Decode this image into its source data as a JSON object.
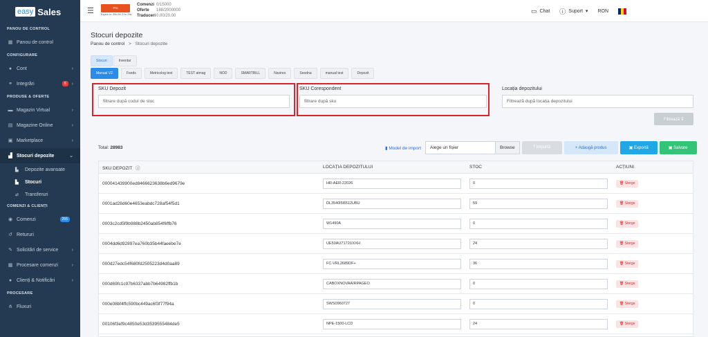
{
  "brand": {
    "part1": "easy",
    "part2": "Sales"
  },
  "sidebar": {
    "sections": {
      "panou": "PANOU DE CONTROL",
      "configurare": "CONFIGURARE",
      "produse": "PRODUSE & OFERTE",
      "comenzi": "COMENZI & CLIENȚI",
      "procesare": "PROCESARE"
    },
    "items": {
      "panou_control": "Panou de control",
      "cont": "Cont",
      "integrari": "Integrări",
      "integrari_badge": "6",
      "magazin_virtual": "Magazin Virtual",
      "magazine_online": "Magazine Online",
      "marketplace": "Marketplace",
      "stocuri_depozite": "Stocuri depozite",
      "depozite_avansate": "Depozite avansate",
      "stocuri": "Stocuri",
      "transferuri": "Transferuri",
      "comenzi": "Comenzi",
      "comenzi_badge": "255",
      "retururi": "Retururi",
      "solicitari": "Solicitări de service",
      "procesare_comenzi": "Procesare comenzi",
      "clienti": "Clienți & Notificări",
      "fluxuri": "Fluxuri"
    },
    "colors": {
      "badge_red": "#e53e3e",
      "badge_blue": "#2a8be8"
    }
  },
  "topbar": {
    "plan": "Pro",
    "expiry": "Expiră în: 35d 6h 37m 29s",
    "comenzi_label": "Comenzi",
    "comenzi_value": "0/15000",
    "oferte_label": "Oferte",
    "oferte_value": "188/2000000",
    "traduceri_label": "Traduceri",
    "traduceri_value": "0.00/20.00",
    "chat": "Chat",
    "suport": "Suport",
    "currency": "RON"
  },
  "page": {
    "title": "Stocuri depozite",
    "breadcrumb_home": "Panou de control",
    "breadcrumb_sep": ">",
    "breadcrumb_current": "Stocuri depozite"
  },
  "tabs_top": [
    "Stocuri",
    "Inventar"
  ],
  "tabs_sub": [
    "Manual V2",
    "Feeds",
    "Metricolog test",
    "TEST atmag",
    "NOD",
    "SMARTBILL",
    "Navireo",
    "Seodna",
    "manual test",
    "Depozit"
  ],
  "filters": {
    "sku_label": "SKU Depozit",
    "sku_placeholder": "filtrare după codul de stoc",
    "corespondent_label": "SKU Corespondent",
    "corespondent_placeholder": "filtrare după sku",
    "locatie_label": "Locația depozitului",
    "locatie_placeholder": "Filtrează după locația depozitului",
    "filtreaza": "Filtrează ⊽"
  },
  "toolbar": {
    "total_label": "Total:",
    "total_value": "28983",
    "model_import": "Model de import",
    "file_placeholder": "Alege un fișier",
    "browse": "Browse",
    "importa": "⤒ Importă",
    "adauga": "+ Adaugă produs",
    "exporta": "▣ Exportă",
    "salvare": "▣ Salvare"
  },
  "table": {
    "headers": [
      "SKU DEPOZIT",
      "LOCAȚIA DEPOZITULUI",
      "STOC",
      "ACȚIUNI"
    ],
    "delete_label": "🗑 Sterge",
    "rows": [
      {
        "sku": "000041439900ed8466623638b6ed9679e",
        "loc": "HR-AER-22026",
        "stoc": "0"
      },
      {
        "sku": "0001ad28d60e4653eabdc728af54f5d1",
        "loc": "DL3540l5l6512UBU",
        "stoc": "59"
      },
      {
        "sku": "0003c2cd5f9b988b2450ab854f6ffb76",
        "loc": "W1490A",
        "stoc": "0"
      },
      {
        "sku": "0004dd6d92897ea760b35b44faeebe7e",
        "loc": "UE50AU7172UXXH",
        "stoc": "24"
      },
      {
        "sku": "000d27edc54f680fd2505223d4d0aa89",
        "loc": "FC-VRL2689DF+",
        "stoc": "36"
      },
      {
        "sku": "000d69fc1c97b6337abb7b64982ffb1b",
        "loc": "CABOXNOVAAIRPAGEO",
        "stoc": "0"
      },
      {
        "sku": "000e08bf4ffc590bc449ac6f3f77f94a",
        "loc": "SWS0960727",
        "stoc": "0"
      },
      {
        "sku": "00106f3ef9c4850e53d3539555484de5",
        "loc": "NPE-1500-LCD",
        "stoc": "24"
      }
    ]
  }
}
